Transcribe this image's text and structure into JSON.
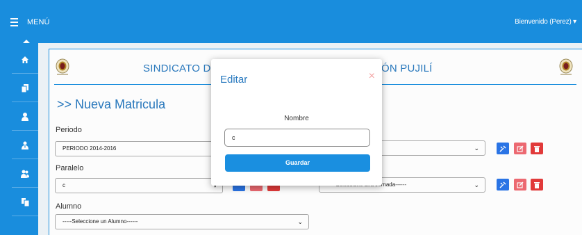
{
  "topbar": {
    "menu_label": "MENÚ",
    "welcome": "Bienvenido (Perez) ▾"
  },
  "sidebar": {
    "items": [
      "home-icon",
      "copy-icon",
      "user-icon",
      "user-tie-icon",
      "users-icon",
      "files-icon"
    ]
  },
  "header": {
    "title_left": "SINDICATO DE C",
    "title_right": "ÓN PUJILÍ"
  },
  "form": {
    "heading": ">> Nueva Matricula",
    "periodo_label": "Periodo",
    "periodo_value": "PERIODO 2014-2016",
    "paralelo_label": "Paralelo",
    "paralelo_value": "c",
    "alumno_label": "Alumno",
    "alumno_value": "-----Seleccione un Alumno------",
    "jornada_value": "-----Seleccione una Jornada------"
  },
  "modal": {
    "title": "Editar",
    "close": "×",
    "field_label": "Nombre",
    "field_value": "c",
    "save_label": "Guardar"
  },
  "colors": {
    "primary": "#1a8fe0",
    "title": "#2a7abf",
    "edit": "#2b76e8",
    "update": "#ef6b73",
    "delete": "#e43b3b"
  }
}
